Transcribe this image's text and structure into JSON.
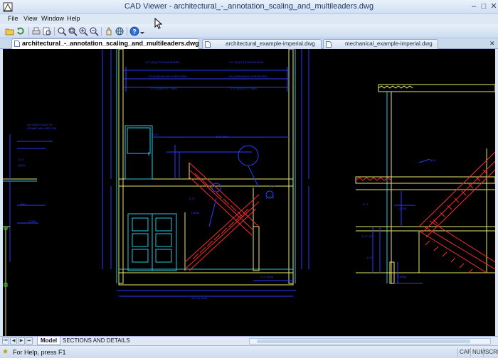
{
  "window": {
    "title": "CAD Viewer - architectural_-_annotation_scaling_and_multileaders.dwg",
    "minimize": "–",
    "maximize": "□",
    "close": "✕"
  },
  "menu": {
    "items": [
      "File",
      "View",
      "Window",
      "Help"
    ]
  },
  "toolbar": {
    "buttons": [
      "open-icon",
      "refresh-icon",
      "print-icon",
      "print-preview-icon",
      "zoom-extents-icon",
      "zoom-window-icon",
      "zoom-in-icon",
      "zoom-out-icon",
      "pan-icon",
      "globe-icon",
      "help-icon"
    ]
  },
  "tabs": [
    {
      "label": "architectural_-_annotation_scaling_and_multileaders.dwg",
      "active": true
    },
    {
      "label": "architectural_example-imperial.dwg",
      "active": false
    },
    {
      "label": "mechanical_example-imperial.dwg",
      "active": false
    }
  ],
  "tab_close": "✕",
  "layout_tabs": {
    "nav": [
      "⏮",
      "◀",
      "▶",
      "⏭"
    ],
    "items": [
      "Model",
      "SECTIONS AND DETAILS"
    ]
  },
  "status": {
    "text": "For Help, press F1",
    "indicators": [
      "CAP",
      "NUM",
      "SCRL"
    ]
  },
  "colors": {
    "canvas": "#000000",
    "blue": "#2a3dff",
    "cyan": "#29c6e0",
    "yellow": "#e8e86a",
    "red": "#ff2a2a",
    "green": "#3fdc3f",
    "white": "#e8e8e8"
  }
}
